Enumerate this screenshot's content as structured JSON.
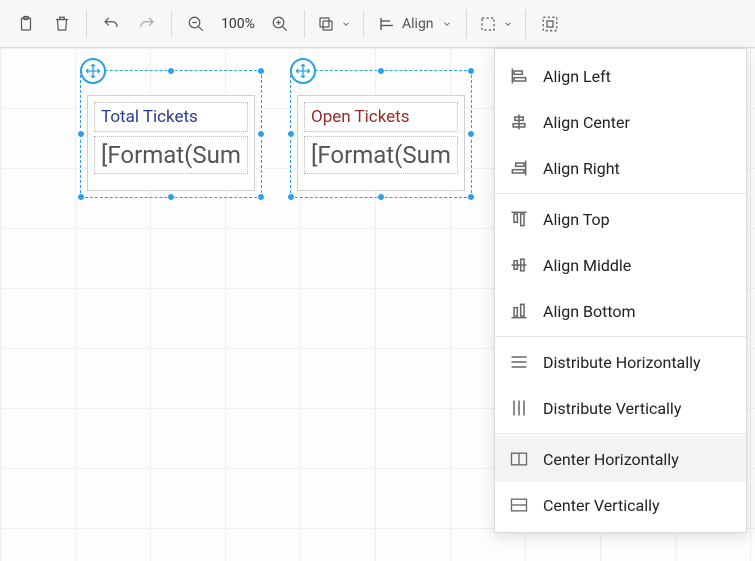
{
  "toolbar": {
    "zoom_label": "100%",
    "align_label": "Align"
  },
  "canvas": {
    "cards": [
      {
        "title": "Total Tickets",
        "value": "[Format(Sum"
      },
      {
        "title": "Open Tickets",
        "value": "[Format(Sum"
      }
    ]
  },
  "menu": {
    "items": [
      {
        "id": "align-left",
        "label": "Align Left"
      },
      {
        "id": "align-center",
        "label": "Align Center"
      },
      {
        "id": "align-right",
        "label": "Align Right"
      },
      {
        "sep": true
      },
      {
        "id": "align-top",
        "label": "Align Top",
        "highlighted": true
      },
      {
        "id": "align-middle",
        "label": "Align Middle"
      },
      {
        "id": "align-bottom",
        "label": "Align Bottom"
      },
      {
        "sep": true
      },
      {
        "id": "dist-h",
        "label": "Distribute Horizontally"
      },
      {
        "id": "dist-v",
        "label": "Distribute Vertically"
      },
      {
        "sep": true
      },
      {
        "id": "center-h",
        "label": "Center Horizontally",
        "hover": true
      },
      {
        "id": "center-v",
        "label": "Center Vertically"
      }
    ]
  }
}
